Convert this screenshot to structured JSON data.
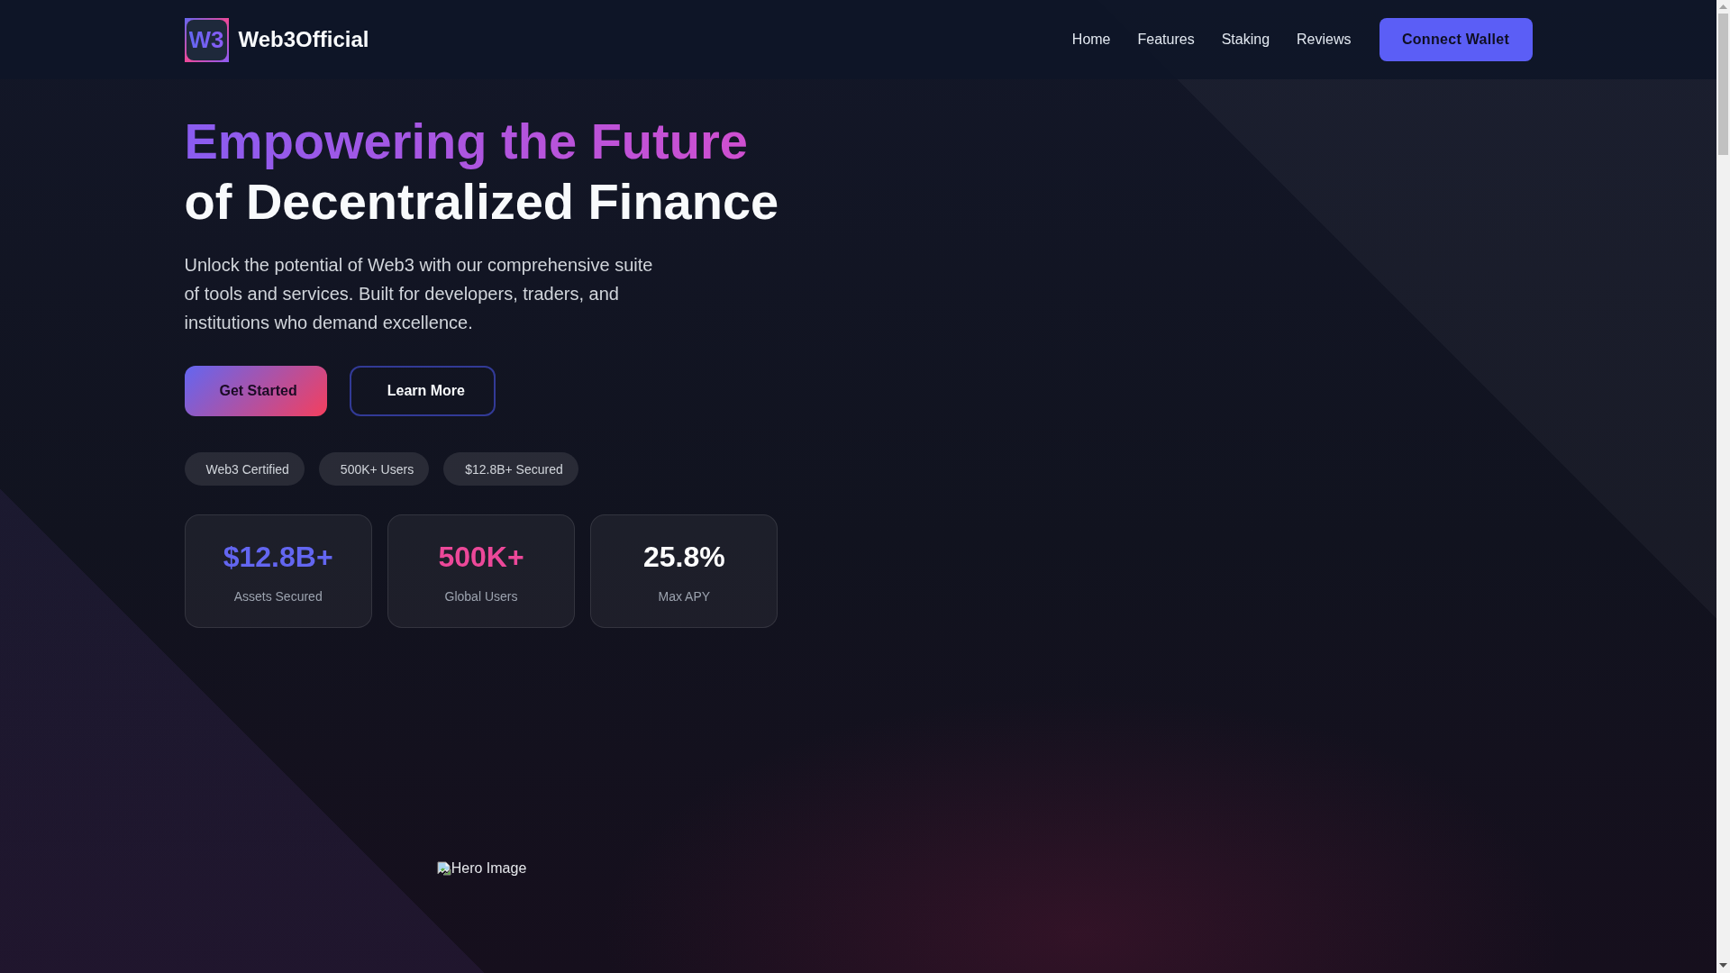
{
  "header": {
    "logo_mark": "W3",
    "brand": "Web3Official",
    "nav": [
      "Home",
      "Features",
      "Staking",
      "Reviews"
    ],
    "cta": "Connect Wallet"
  },
  "hero": {
    "title_highlight": "Empowering the Future",
    "title_rest": "of Decentralized Finance",
    "description": "Unlock the potential of Web3 with our comprehensive suite of tools and services. Built for developers, traders, and institutions who demand excellence.",
    "buttons": [
      {
        "label": "Get Started",
        "kind": "primary"
      },
      {
        "label": "Learn More",
        "kind": "outline"
      }
    ],
    "badges": [
      "Web3 Certified",
      "500K+ Users",
      "$12.8B+ Secured"
    ],
    "stats": [
      {
        "value": "$12.8B+",
        "label": "Assets Secured",
        "color": "#6366f1"
      },
      {
        "value": "500K+",
        "label": "Global Users",
        "color": "#ec4899"
      },
      {
        "value": "25.8%",
        "label": "Max APY",
        "color": "#ffffff"
      }
    ],
    "image_alt": "Hero Image"
  }
}
